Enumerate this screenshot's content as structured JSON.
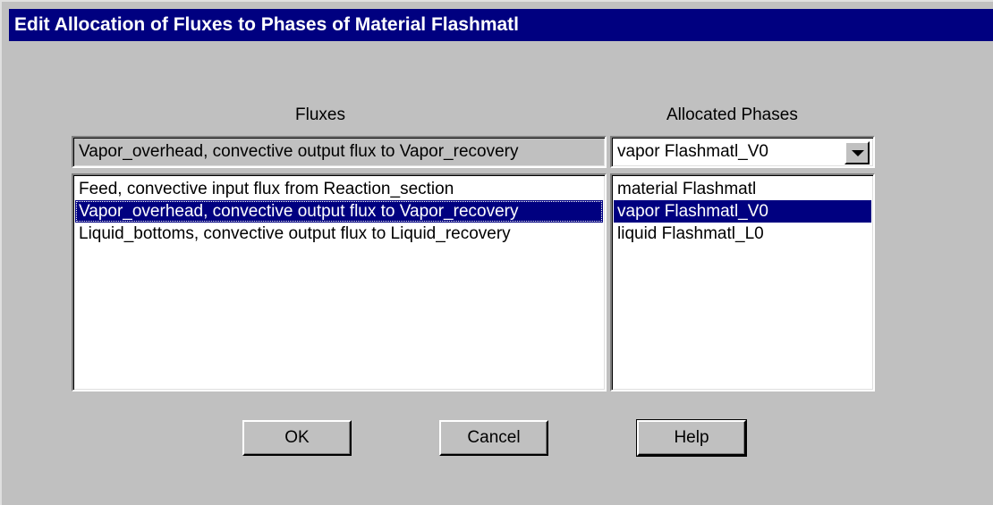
{
  "dialog": {
    "title": "Edit Allocation of Fluxes to Phases of Material Flashmatl"
  },
  "fluxes": {
    "header": "Fluxes",
    "current_value": "Vapor_overhead, convective output flux to Vapor_recovery",
    "items": [
      {
        "label": "Feed, convective input flux from Reaction_section",
        "selected": false
      },
      {
        "label": "Vapor_overhead, convective output flux to Vapor_recovery",
        "selected": true
      },
      {
        "label": "Liquid_bottoms, convective output flux to Liquid_recovery",
        "selected": false
      }
    ]
  },
  "phases": {
    "header": "Allocated Phases",
    "current_value": "vapor Flashmatl_V0",
    "dropdown_icon": "chevron-down-icon",
    "items": [
      {
        "label": "material Flashmatl",
        "selected": false
      },
      {
        "label": "vapor Flashmatl_V0",
        "selected": true
      },
      {
        "label": "liquid Flashmatl_L0",
        "selected": false
      }
    ]
  },
  "buttons": {
    "ok": "OK",
    "cancel": "Cancel",
    "help": "Help"
  },
  "colors": {
    "titlebar": "#000080",
    "face": "#c0c0c0",
    "selection": "#000080"
  }
}
